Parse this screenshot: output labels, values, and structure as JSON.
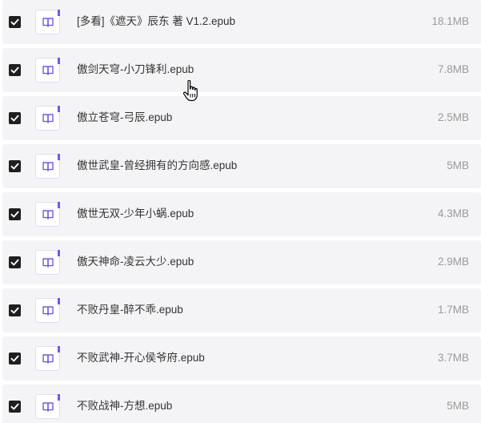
{
  "colors": {
    "row_background": "#f4f4f6",
    "checkbox": "#1f1f1f",
    "icon_accent": "#6f5be0",
    "name_text": "#333333",
    "size_text": "#9a9a9a"
  },
  "files": [
    {
      "name": "[多看]《遮天》辰东 著 V1.2.epub",
      "size": "18.1MB",
      "checked": true,
      "icon": "book-icon"
    },
    {
      "name": "傲剑天穹-小刀锋利.epub",
      "size": "7.8MB",
      "checked": true,
      "icon": "book-icon"
    },
    {
      "name": "傲立苍穹-弓辰.epub",
      "size": "2.5MB",
      "checked": true,
      "icon": "book-icon"
    },
    {
      "name": "傲世武皇-曾经拥有的方向感.epub",
      "size": "5MB",
      "checked": true,
      "icon": "book-icon"
    },
    {
      "name": "傲世无双-少年小蜗.epub",
      "size": "4.3MB",
      "checked": true,
      "icon": "book-icon"
    },
    {
      "name": "傲天神命-凌云大少.epub",
      "size": "2.9MB",
      "checked": true,
      "icon": "book-icon"
    },
    {
      "name": "不败丹皇-醉不乖.epub",
      "size": "1.7MB",
      "checked": true,
      "icon": "book-icon"
    },
    {
      "name": "不败武神-开心侯爷府.epub",
      "size": "3.7MB",
      "checked": true,
      "icon": "book-icon"
    },
    {
      "name": "不败战神-方想.epub",
      "size": "5MB",
      "checked": true,
      "icon": "book-icon"
    }
  ],
  "cursor": {
    "icon": "hand-pointer-icon"
  }
}
